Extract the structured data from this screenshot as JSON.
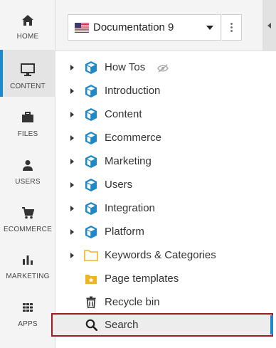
{
  "rail": {
    "items": [
      {
        "label": "HOME",
        "icon": "home-icon"
      },
      {
        "label": "CONTENT",
        "icon": "monitor-icon",
        "active": true
      },
      {
        "label": "FILES",
        "icon": "briefcase-icon"
      },
      {
        "label": "USERS",
        "icon": "user-icon"
      },
      {
        "label": "ECOMMERCE",
        "icon": "cart-icon"
      },
      {
        "label": "MARKETING",
        "icon": "bar-chart-icon"
      },
      {
        "label": "APPS",
        "icon": "apps-grid-icon"
      }
    ]
  },
  "site_selector": {
    "value": "Documentation 9",
    "flag": "us-flag-icon"
  },
  "tree": {
    "items": [
      {
        "label": "How Tos",
        "icon": "cube-icon",
        "expandable": true,
        "hidden": true
      },
      {
        "label": "Introduction",
        "icon": "cube-icon",
        "expandable": true
      },
      {
        "label": "Content",
        "icon": "cube-icon",
        "expandable": true
      },
      {
        "label": "Ecommerce",
        "icon": "cube-icon",
        "expandable": true
      },
      {
        "label": "Marketing",
        "icon": "cube-icon",
        "expandable": true
      },
      {
        "label": "Users",
        "icon": "cube-icon",
        "expandable": true
      },
      {
        "label": "Integration",
        "icon": "cube-icon",
        "expandable": true
      },
      {
        "label": "Platform",
        "icon": "cube-icon",
        "expandable": true
      },
      {
        "label": "Keywords & Categories",
        "icon": "folder-icon",
        "expandable": true
      },
      {
        "label": "Page templates",
        "icon": "star-folder-icon",
        "expandable": false
      },
      {
        "label": "Recycle bin",
        "icon": "trash-icon",
        "expandable": false
      }
    ],
    "search": {
      "label": "Search",
      "icon": "search-icon"
    }
  },
  "colors": {
    "accent": "#1e88c8",
    "cube": "#1e88c8",
    "folder": "#f0b323",
    "highlight_border": "#9a1f24"
  }
}
